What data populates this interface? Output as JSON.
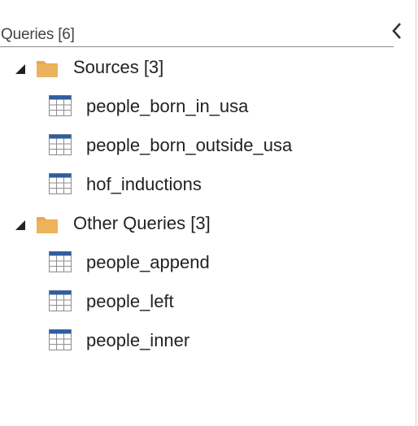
{
  "pane": {
    "title": "Queries [6]",
    "collapse_icon": "chevron-left-icon"
  },
  "groups": [
    {
      "label": "Sources [3]",
      "expanded": true,
      "items": [
        {
          "label": "people_born_in_usa"
        },
        {
          "label": "people_born_outside_usa"
        },
        {
          "label": "hof_inductions"
        }
      ]
    },
    {
      "label": "Other Queries [3]",
      "expanded": true,
      "items": [
        {
          "label": "people_append"
        },
        {
          "label": "people_left"
        },
        {
          "label": "people_inner"
        }
      ]
    }
  ],
  "colors": {
    "folder": "#E8A84C",
    "table_header": "#2E5E9E",
    "table_grid": "#8D8D8D",
    "expander": "#222222"
  }
}
